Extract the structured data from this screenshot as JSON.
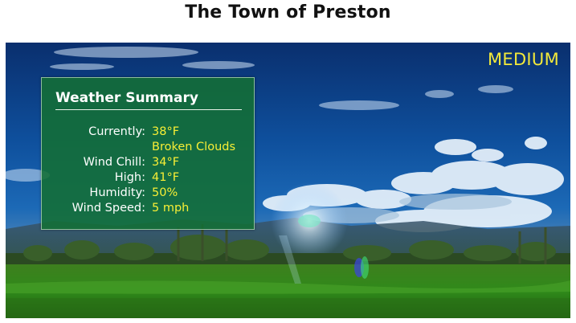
{
  "header": {
    "title": "The Town of Preston"
  },
  "hero": {
    "mode_label": "MEDIUM",
    "mode_color": "#f2e93a"
  },
  "summary": {
    "title": "Weather Summary",
    "currently_label": "Currently:",
    "currently_value": "38°F",
    "condition": "Broken Clouds",
    "wind_chill_label": "Wind Chill:",
    "wind_chill_value": "34°F",
    "high_label": "High:",
    "high_value": "41°F",
    "humidity_label": "Humidity:",
    "humidity_value": "50%",
    "wind_speed_label": "Wind Speed:",
    "wind_speed_value": "5 mph",
    "panel_color": "#136e34",
    "value_color": "#f7ee35"
  }
}
